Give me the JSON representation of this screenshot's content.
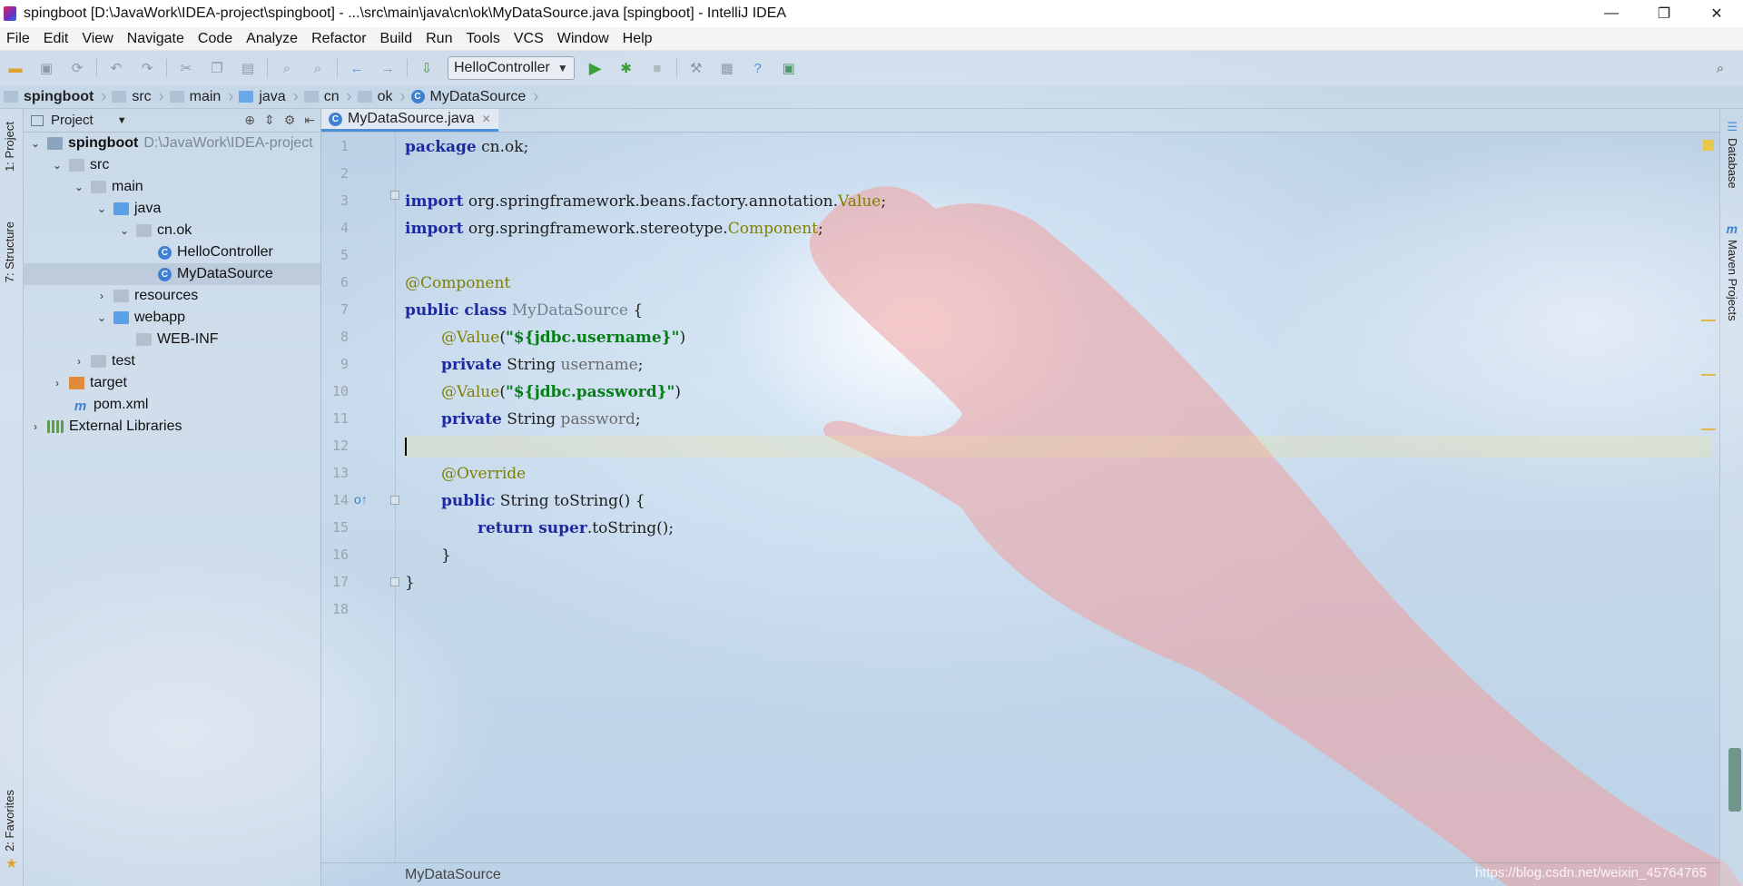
{
  "window": {
    "title": "spingboot [D:\\JavaWork\\IDEA-project\\spingboot] - ...\\src\\main\\java\\cn\\ok\\MyDataSource.java [spingboot] - IntelliJ IDEA",
    "minimize": "—",
    "restore": "❐",
    "close": "✕"
  },
  "menu": [
    "File",
    "Edit",
    "View",
    "Navigate",
    "Code",
    "Analyze",
    "Refactor",
    "Build",
    "Run",
    "Tools",
    "VCS",
    "Window",
    "Help"
  ],
  "toolbar": {
    "run_config": "HelloController"
  },
  "breadcrumb": [
    "spingboot",
    "src",
    "main",
    "java",
    "cn",
    "ok",
    "MyDataSource"
  ],
  "left_strip": {
    "project_tab": "1: Project",
    "structure_tab": "7: Structure",
    "favorites_tab": "2: Favorites"
  },
  "right_strip": {
    "database_tab": "Database",
    "maven_tab": "Maven Projects"
  },
  "project_panel": {
    "title": "Project",
    "tree": [
      {
        "label": "spingboot",
        "hint": "D:\\JavaWork\\IDEA-project"
      },
      {
        "label": "src"
      },
      {
        "label": "main"
      },
      {
        "label": "java"
      },
      {
        "label": "cn.ok"
      },
      {
        "label": "HelloController"
      },
      {
        "label": "MyDataSource"
      },
      {
        "label": "resources"
      },
      {
        "label": "webapp"
      },
      {
        "label": "WEB-INF"
      },
      {
        "label": "test"
      },
      {
        "label": "target"
      },
      {
        "label": "pom.xml"
      },
      {
        "label": "External Libraries"
      }
    ]
  },
  "editor": {
    "tab": "MyDataSource.java",
    "line_numbers": [
      "1",
      "2",
      "3",
      "4",
      "5",
      "6",
      "7",
      "8",
      "9",
      "10",
      "11",
      "12",
      "13",
      "14",
      "15",
      "16",
      "17",
      "18"
    ],
    "code": {
      "l1_kw": "package",
      "l1_rest": " cn.ok;",
      "l3_kw": "import",
      "l3_rest": " org.springframework.beans.factory.annotation.",
      "l3_cls": "Value",
      "l3_end": ";",
      "l4_kw": "import",
      "l4_rest": " org.springframework.stereotype.",
      "l4_cls": "Component",
      "l4_end": ";",
      "l6_ann": "@Component",
      "l7_kw1": "public",
      "l7_kw2": " class",
      "l7_cls": " MyDataSource",
      "l7_end": " {",
      "l8_ann": "@Value",
      "l8_p1": "(",
      "l8_str": "\"${jdbc.username}\"",
      "l8_p2": ")",
      "l9_kw": "private",
      "l9_type": " String",
      "l9_fld": " username",
      "l9_end": ";",
      "l10_ann": "@Value",
      "l10_p1": "(",
      "l10_str": "\"${jdbc.password}\"",
      "l10_p2": ")",
      "l11_kw": "private",
      "l11_type": " String",
      "l11_fld": " password",
      "l11_end": ";",
      "l13_ann": "@Override",
      "l14_kw": "public",
      "l14_rest": " String toString() {",
      "l15_kw1": "return",
      "l15_kw2": " super",
      "l15_rest": ".toString();",
      "l16": "}",
      "l17": "}"
    },
    "status_breadcrumb": "MyDataSource"
  },
  "watermark": "https://blog.csdn.net/weixin_45764765",
  "colors": {
    "keyword": "#1d2aa0",
    "annotation": "#808000",
    "string": "#067d17",
    "accent": "#4a90d9"
  }
}
